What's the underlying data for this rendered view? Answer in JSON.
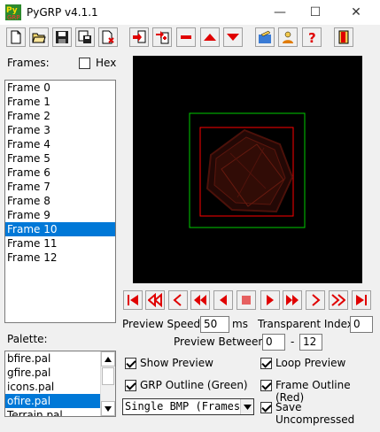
{
  "window": {
    "title": "PyGRP v4.1.1",
    "minimize": "—",
    "maximize": "☐",
    "close": "✕"
  },
  "toolbar": {
    "icons": [
      "new-icon",
      "open-icon",
      "save-icon",
      "save-as-icon",
      "close-file-icon",
      "import-frames-icon",
      "insert-frames-icon",
      "delete-frames-icon",
      "move-up-icon",
      "move-down-icon",
      "tools-icon",
      "help-people-icon",
      "help-icon",
      "exit-icon"
    ]
  },
  "frames": {
    "label": "Frames:",
    "hex_label": "Hex",
    "hex_checked": false,
    "items": [
      "Frame 0",
      "Frame 1",
      "Frame 2",
      "Frame 3",
      "Frame 4",
      "Frame 5",
      "Frame 6",
      "Frame 7",
      "Frame 8",
      "Frame 9",
      "Frame 10",
      "Frame 11",
      "Frame 12"
    ],
    "selected": "Frame 10"
  },
  "palette": {
    "label": "Palette:",
    "items": [
      "bfire.pal",
      "gfire.pal",
      "icons.pal",
      "ofire.pal",
      "Terrain.pal"
    ],
    "selected": "ofire.pal"
  },
  "playback": {
    "buttons": [
      "first-frame",
      "back-10",
      "back-1",
      "play-backward",
      "step-back",
      "stop",
      "step-forward",
      "play-forward",
      "forward-1",
      "forward-10",
      "last-frame"
    ]
  },
  "settings": {
    "preview_speed_label": "Preview Speed:",
    "preview_speed_value": "50",
    "ms_label": "ms",
    "transparent_index_label": "Transparent Index:",
    "transparent_index_value": "0",
    "preview_between_label": "Preview Between:",
    "preview_between_from": "0",
    "preview_between_dash": "-",
    "preview_between_to": "12"
  },
  "options": {
    "show_preview": {
      "label": "Show Preview",
      "checked": true
    },
    "loop_preview": {
      "label": "Loop Preview",
      "checked": true
    },
    "grp_outline": {
      "label": "GRP Outline (Green)",
      "checked": true
    },
    "frame_outline": {
      "label": "Frame Outline (Red)",
      "checked": true
    },
    "save_uncompressed": {
      "label": "Save Uncompressed",
      "checked": true
    },
    "bmp_mode": "Single BMP (Framesets)"
  },
  "colors": {
    "selection": "#0078d7",
    "grp_outline": "#00cc00",
    "frame_outline": "#ff0000",
    "nav_red": "#e00000"
  }
}
